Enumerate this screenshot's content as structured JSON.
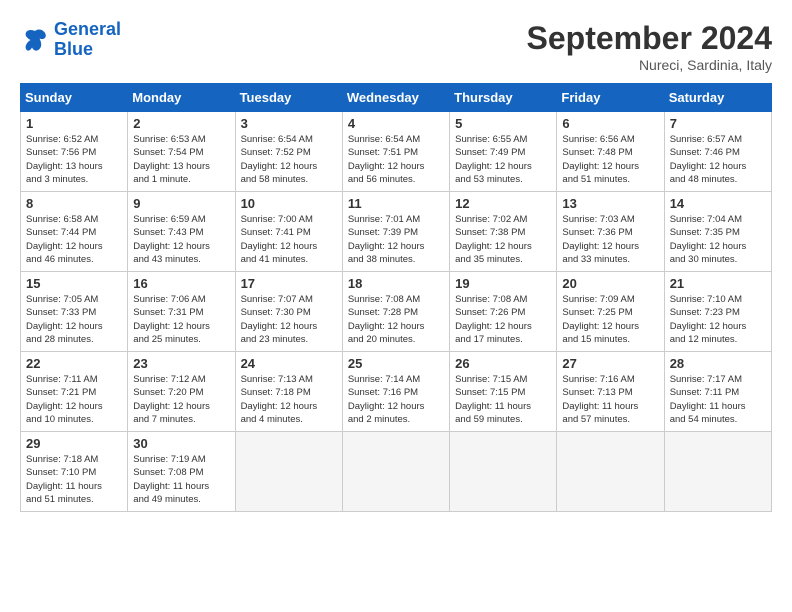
{
  "header": {
    "logo": {
      "line1": "General",
      "line2": "Blue"
    },
    "title": "September 2024",
    "subtitle": "Nureci, Sardinia, Italy"
  },
  "calendar": {
    "columns": [
      "Sunday",
      "Monday",
      "Tuesday",
      "Wednesday",
      "Thursday",
      "Friday",
      "Saturday"
    ],
    "weeks": [
      [
        {
          "day": null,
          "info": null
        },
        {
          "day": "2",
          "info": "Sunrise: 6:53 AM\nSunset: 7:54 PM\nDaylight: 13 hours\nand 1 minute."
        },
        {
          "day": "3",
          "info": "Sunrise: 6:54 AM\nSunset: 7:52 PM\nDaylight: 12 hours\nand 58 minutes."
        },
        {
          "day": "4",
          "info": "Sunrise: 6:54 AM\nSunset: 7:51 PM\nDaylight: 12 hours\nand 56 minutes."
        },
        {
          "day": "5",
          "info": "Sunrise: 6:55 AM\nSunset: 7:49 PM\nDaylight: 12 hours\nand 53 minutes."
        },
        {
          "day": "6",
          "info": "Sunrise: 6:56 AM\nSunset: 7:48 PM\nDaylight: 12 hours\nand 51 minutes."
        },
        {
          "day": "7",
          "info": "Sunrise: 6:57 AM\nSunset: 7:46 PM\nDaylight: 12 hours\nand 48 minutes."
        }
      ],
      [
        {
          "day": "1",
          "info": "Sunrise: 6:52 AM\nSunset: 7:56 PM\nDaylight: 13 hours\nand 3 minutes."
        },
        {
          "day": "8",
          "info": "Sunrise: 6:58 AM\nSunset: 7:44 PM\nDaylight: 12 hours\nand 46 minutes."
        },
        {
          "day": "9",
          "info": "Sunrise: 6:59 AM\nSunset: 7:43 PM\nDaylight: 12 hours\nand 43 minutes."
        },
        {
          "day": "10",
          "info": "Sunrise: 7:00 AM\nSunset: 7:41 PM\nDaylight: 12 hours\nand 41 minutes."
        },
        {
          "day": "11",
          "info": "Sunrise: 7:01 AM\nSunset: 7:39 PM\nDaylight: 12 hours\nand 38 minutes."
        },
        {
          "day": "12",
          "info": "Sunrise: 7:02 AM\nSunset: 7:38 PM\nDaylight: 12 hours\nand 35 minutes."
        },
        {
          "day": "13",
          "info": "Sunrise: 7:03 AM\nSunset: 7:36 PM\nDaylight: 12 hours\nand 33 minutes."
        },
        {
          "day": "14",
          "info": "Sunrise: 7:04 AM\nSunset: 7:35 PM\nDaylight: 12 hours\nand 30 minutes."
        }
      ],
      [
        {
          "day": "15",
          "info": "Sunrise: 7:05 AM\nSunset: 7:33 PM\nDaylight: 12 hours\nand 28 minutes."
        },
        {
          "day": "16",
          "info": "Sunrise: 7:06 AM\nSunset: 7:31 PM\nDaylight: 12 hours\nand 25 minutes."
        },
        {
          "day": "17",
          "info": "Sunrise: 7:07 AM\nSunset: 7:30 PM\nDaylight: 12 hours\nand 23 minutes."
        },
        {
          "day": "18",
          "info": "Sunrise: 7:08 AM\nSunset: 7:28 PM\nDaylight: 12 hours\nand 20 minutes."
        },
        {
          "day": "19",
          "info": "Sunrise: 7:08 AM\nSunset: 7:26 PM\nDaylight: 12 hours\nand 17 minutes."
        },
        {
          "day": "20",
          "info": "Sunrise: 7:09 AM\nSunset: 7:25 PM\nDaylight: 12 hours\nand 15 minutes."
        },
        {
          "day": "21",
          "info": "Sunrise: 7:10 AM\nSunset: 7:23 PM\nDaylight: 12 hours\nand 12 minutes."
        }
      ],
      [
        {
          "day": "22",
          "info": "Sunrise: 7:11 AM\nSunset: 7:21 PM\nDaylight: 12 hours\nand 10 minutes."
        },
        {
          "day": "23",
          "info": "Sunrise: 7:12 AM\nSunset: 7:20 PM\nDaylight: 12 hours\nand 7 minutes."
        },
        {
          "day": "24",
          "info": "Sunrise: 7:13 AM\nSunset: 7:18 PM\nDaylight: 12 hours\nand 4 minutes."
        },
        {
          "day": "25",
          "info": "Sunrise: 7:14 AM\nSunset: 7:16 PM\nDaylight: 12 hours\nand 2 minutes."
        },
        {
          "day": "26",
          "info": "Sunrise: 7:15 AM\nSunset: 7:15 PM\nDaylight: 11 hours\nand 59 minutes."
        },
        {
          "day": "27",
          "info": "Sunrise: 7:16 AM\nSunset: 7:13 PM\nDaylight: 11 hours\nand 57 minutes."
        },
        {
          "day": "28",
          "info": "Sunrise: 7:17 AM\nSunset: 7:11 PM\nDaylight: 11 hours\nand 54 minutes."
        }
      ],
      [
        {
          "day": "29",
          "info": "Sunrise: 7:18 AM\nSunset: 7:10 PM\nDaylight: 11 hours\nand 51 minutes."
        },
        {
          "day": "30",
          "info": "Sunrise: 7:19 AM\nSunset: 7:08 PM\nDaylight: 11 hours\nand 49 minutes."
        },
        {
          "day": null,
          "info": null
        },
        {
          "day": null,
          "info": null
        },
        {
          "day": null,
          "info": null
        },
        {
          "day": null,
          "info": null
        },
        {
          "day": null,
          "info": null
        }
      ]
    ]
  }
}
